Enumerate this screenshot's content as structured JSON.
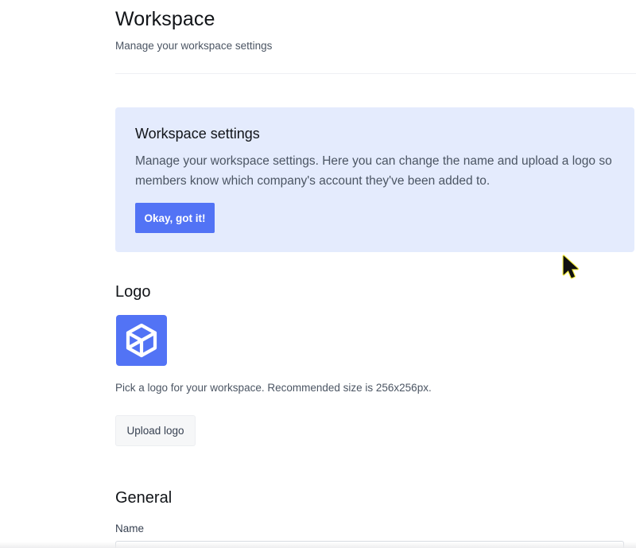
{
  "header": {
    "title": "Workspace",
    "subtitle": "Manage your workspace settings"
  },
  "callout": {
    "title": "Workspace settings",
    "text": "Manage your workspace settings. Here you can change the name and upload a logo so members know which company's account they've been added to.",
    "button_label": "Okay, got it!"
  },
  "logo_section": {
    "title": "Logo",
    "logo_icon": "cube-icon",
    "hint": "Pick a logo for your workspace. Recommended size is 256x256px.",
    "upload_label": "Upload logo"
  },
  "general_section": {
    "title": "General",
    "name_label": "Name",
    "name_value": ""
  },
  "colors": {
    "accent": "#5273f5",
    "callout_bg": "#e4ebfd"
  }
}
